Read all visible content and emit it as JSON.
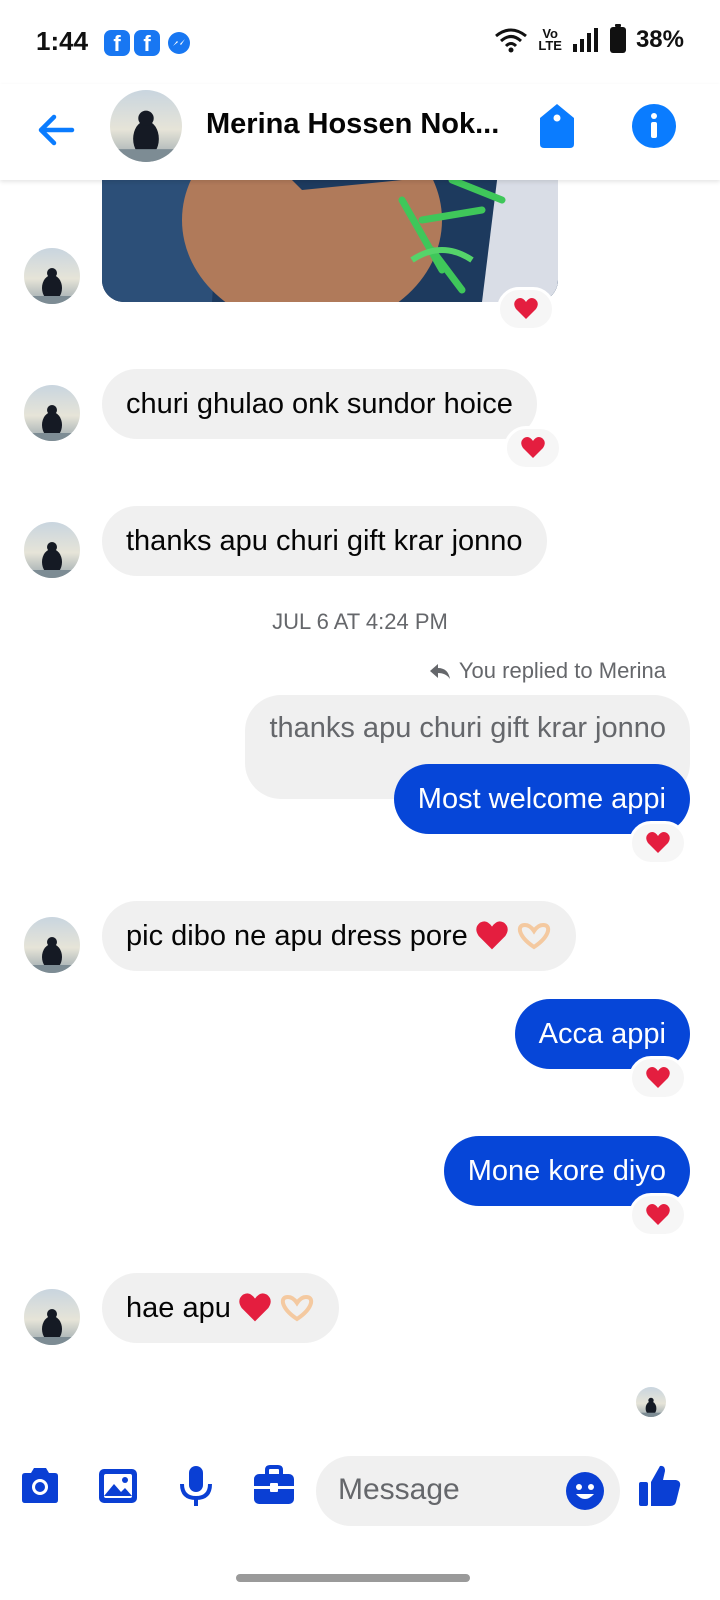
{
  "status_bar": {
    "time": "1:44",
    "volte_top": "Vo",
    "volte_bottom": "LTE",
    "battery_percent": "38%"
  },
  "header": {
    "contact_name": "Merina Hossen Nok..."
  },
  "messages": [
    {
      "from": "them",
      "text": "churi ghulao onk sundor hoice",
      "reaction": "heart"
    },
    {
      "from": "them",
      "text": "thanks apu churi gift krar jonno"
    }
  ],
  "timestamp": "JUL 6 AT 4:24 PM",
  "reply": {
    "label": "You replied to Merina",
    "quoted_text": "thanks apu churi gift krar jonno",
    "text": "Most welcome appi",
    "reaction": "heart"
  },
  "later_messages": [
    {
      "from": "them",
      "text": "pic dibo ne apu dress pore"
    },
    {
      "from": "me",
      "text": "Acca appi",
      "reaction": "heart"
    },
    {
      "from": "me",
      "text": "Mone kore diyo",
      "reaction": "heart"
    },
    {
      "from": "them",
      "text": "hae apu"
    }
  ],
  "composer": {
    "placeholder": "Message"
  },
  "colors": {
    "accent": "#0a7cff",
    "outgoing_bubble": "#0646d8",
    "incoming_bubble": "#f0f0f0",
    "heart": "#e41e3f"
  },
  "icons": [
    "back-arrow-icon",
    "tag-icon",
    "info-icon",
    "camera-icon",
    "image-icon",
    "mic-icon",
    "briefcase-icon",
    "emoji-icon",
    "thumbs-up-icon"
  ]
}
